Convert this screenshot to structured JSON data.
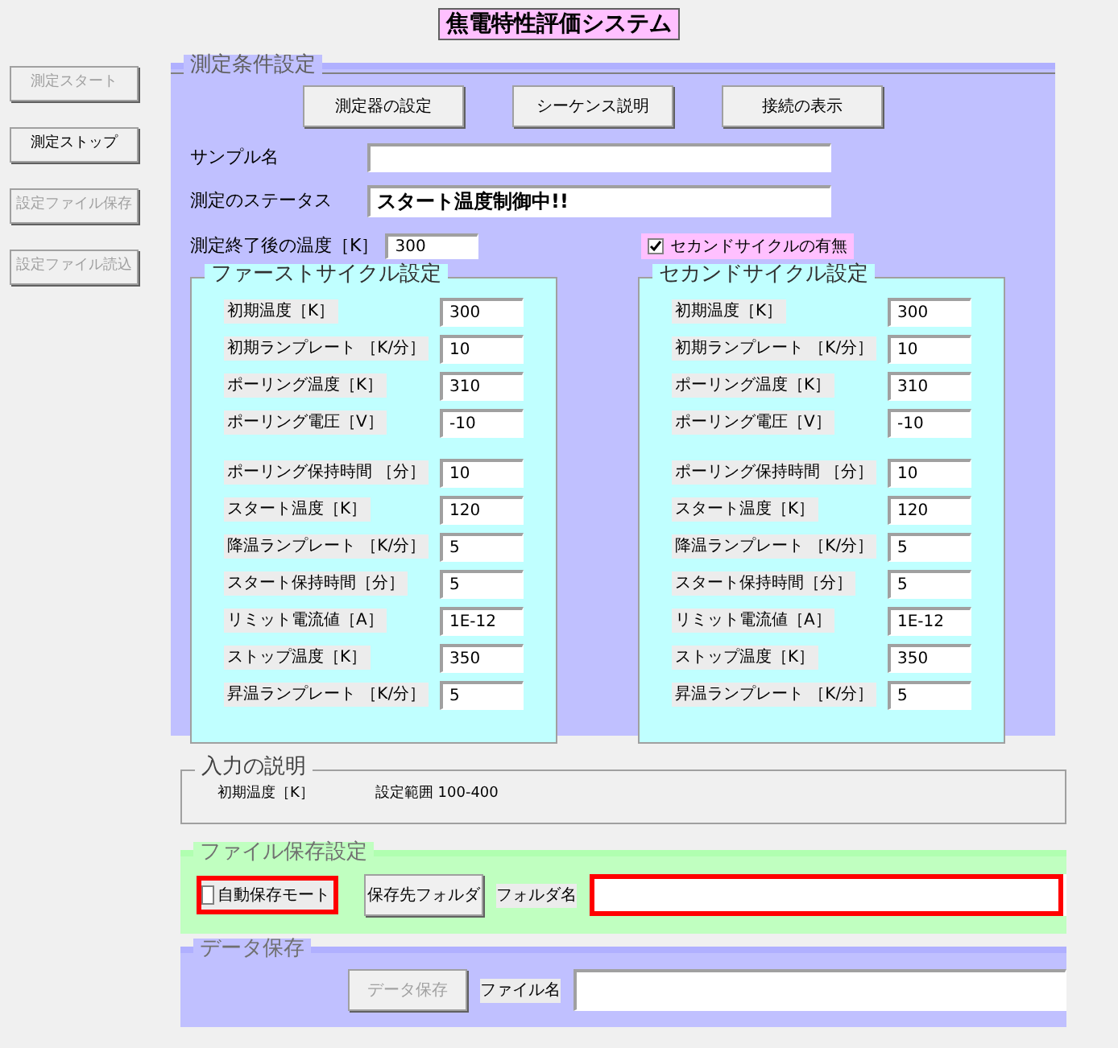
{
  "title": "焦電特性評価システム",
  "side_buttons": [
    {
      "label": "測定スタート",
      "disabled": true
    },
    {
      "label": "測定ストップ",
      "disabled": false
    },
    {
      "label": "設定ファイル保存",
      "disabled": true
    },
    {
      "label": "設定ファイル読込",
      "disabled": true
    }
  ],
  "conditions": {
    "legend": "測定条件設定",
    "buttons": [
      "測定器の設定",
      "シーケンス説明",
      "接続の表示"
    ],
    "sample_name": {
      "label": "サンプル名"
    },
    "status": {
      "label": "測定のステータス",
      "value": "スタート温度制御中!!"
    },
    "end_temp": {
      "label": "測定終了後の温度［K］",
      "value": "300"
    },
    "second_cycle_toggle": {
      "label": "セカンドサイクルの有無",
      "checked": true
    },
    "cycles": [
      {
        "legend": "ファーストサイクル設定",
        "rows": [
          {
            "label": "初期温度［K］",
            "value": "300"
          },
          {
            "label": "初期ランプレート ［K/分］",
            "value": "10"
          },
          {
            "label": "ポーリング温度［K］",
            "value": "310"
          },
          {
            "label": "ポーリング電圧［V］",
            "value": "-10"
          },
          {
            "label": "ポーリング保持時間 ［分］",
            "value": "10"
          },
          {
            "label": "スタート温度［K］",
            "value": "120"
          },
          {
            "label": "降温ランプレート ［K/分］",
            "value": "5"
          },
          {
            "label": "スタート保持時間［分］",
            "value": "5"
          },
          {
            "label": "リミット電流値［A］",
            "value": "1E-12"
          },
          {
            "label": "ストップ温度［K］",
            "value": "350"
          },
          {
            "label": "昇温ランプレート ［K/分］",
            "value": "5"
          }
        ]
      },
      {
        "legend": "セカンドサイクル設定",
        "rows": [
          {
            "label": "初期温度［K］",
            "value": "300"
          },
          {
            "label": "初期ランプレート ［K/分］",
            "value": "10"
          },
          {
            "label": "ポーリング温度［K］",
            "value": "310"
          },
          {
            "label": "ポーリング電圧［V］",
            "value": "-10"
          },
          {
            "label": "ポーリング保持時間 ［分］",
            "value": "10"
          },
          {
            "label": "スタート温度［K］",
            "value": "120"
          },
          {
            "label": "降温ランプレート ［K/分］",
            "value": "5"
          },
          {
            "label": "スタート保持時間［分］",
            "value": "5"
          },
          {
            "label": "リミット電流値［A］",
            "value": "1E-12"
          },
          {
            "label": "ストップ温度［K］",
            "value": "350"
          },
          {
            "label": "昇温ランプレート ［K/分］",
            "value": "5"
          }
        ]
      }
    ]
  },
  "input_help": {
    "legend": "入力の説明",
    "item": "初期温度［K］",
    "range": "設定範囲 100-400"
  },
  "file_save": {
    "legend": "ファイル保存設定",
    "auto_save": {
      "label": "自動保存モート",
      "checked": false,
      "highlighted": true
    },
    "folder_button": "保存先フォルダ",
    "folder_label": "フォルダ名",
    "folder_field": {
      "highlighted": true
    }
  },
  "data_save": {
    "legend": "データ保存",
    "button": {
      "label": "データ保存",
      "disabled": true
    },
    "file_label": "ファイル名"
  }
}
